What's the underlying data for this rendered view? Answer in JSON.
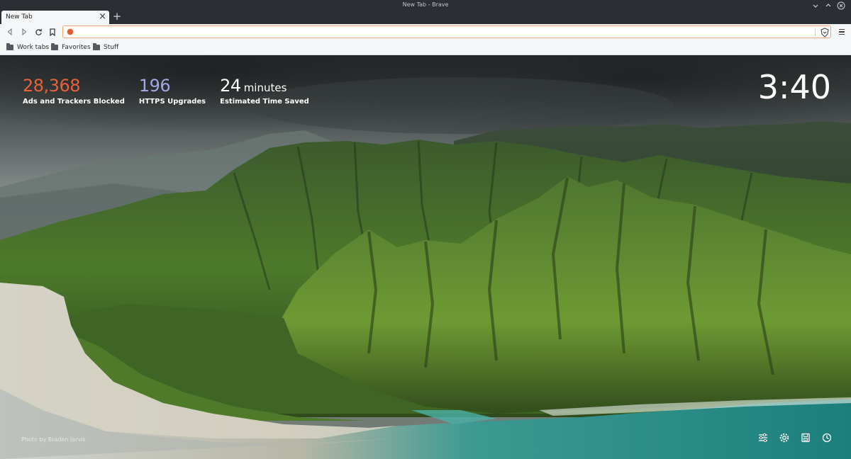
{
  "window": {
    "title": "New Tab - Brave"
  },
  "tabs": [
    {
      "label": "New Tab",
      "active": true
    }
  ],
  "new_tab_symbol": "+",
  "close_symbol": "×",
  "address_bar": {
    "value": "",
    "placeholder": ""
  },
  "bookmarks": [
    {
      "label": "Work tabs",
      "icon": "folder-icon"
    },
    {
      "label": "Favorites",
      "icon": "folder-icon"
    },
    {
      "label": "Stuff",
      "icon": "folder-icon"
    }
  ],
  "stats": {
    "ads_blocked": {
      "value": "28,368",
      "label": "Ads and Trackers Blocked",
      "color": "#e8603c"
    },
    "https_upgrades": {
      "value": "196",
      "label": "HTTPS Upgrades",
      "color": "#a3a7e8"
    },
    "time_saved": {
      "value": "24",
      "unit": "minutes",
      "label": "Estimated Time Saved",
      "color": "#ffffff"
    }
  },
  "clock": "3:40",
  "photo_credit": "Photo by Braden Jarvis",
  "colors": {
    "accent": "#f3a373",
    "titlebar": "#2b2f33",
    "toolbar": "#f5f6f7"
  },
  "icons": {
    "toolbar": [
      "back-icon",
      "forward-icon",
      "reload-icon",
      "bookmark-icon",
      "duckduckgo-icon",
      "brave-shield-icon",
      "menu-icon"
    ],
    "window": [
      "minimize-icon",
      "maximize-icon",
      "close-icon"
    ],
    "ntp_actions": [
      "customize-icon",
      "settings-icon",
      "bookmarks-icon",
      "history-icon"
    ]
  }
}
